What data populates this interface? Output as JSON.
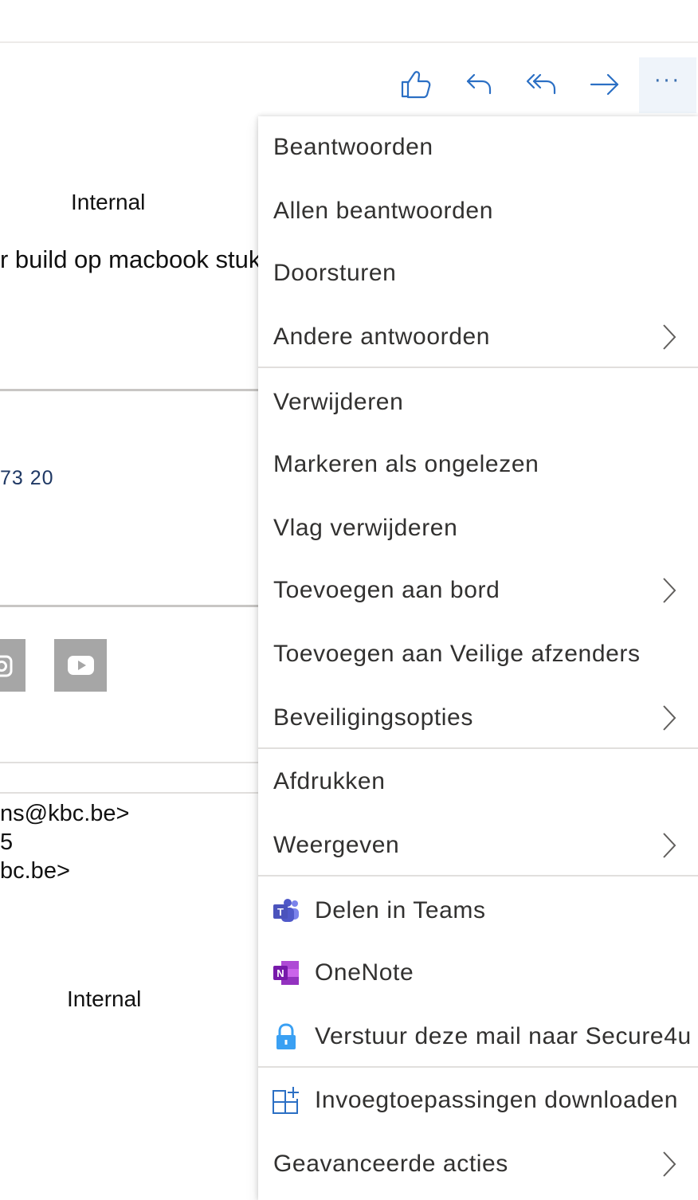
{
  "toolbar": {
    "like_icon": "thumbs-up-icon",
    "reply_icon": "reply-icon",
    "reply_all_icon": "reply-all-icon",
    "forward_icon": "forward-icon",
    "more_label": "···"
  },
  "email_body": {
    "classification_top": "Internal",
    "body_line": "r build op macbook stuk",
    "phone_fragment": "73 20",
    "header_line_1": "ns@kbc.be>",
    "header_line_2": "5",
    "header_line_3": "bc.be>",
    "classification_bottom": "Internal"
  },
  "menu": {
    "items": [
      {
        "label": "Beantwoorden"
      },
      {
        "label": "Allen beantwoorden"
      },
      {
        "label": "Doorsturen"
      },
      {
        "label": "Andere antwoorden",
        "submenu": true
      },
      {
        "label": "Verwijderen"
      },
      {
        "label": "Markeren als ongelezen"
      },
      {
        "label": "Vlag verwijderen"
      },
      {
        "label": "Toevoegen aan bord",
        "submenu": true
      },
      {
        "label": "Toevoegen aan Veilige afzenders"
      },
      {
        "label": "Beveiligingsopties",
        "submenu": true
      },
      {
        "label": "Afdrukken"
      },
      {
        "label": "Weergeven",
        "submenu": true
      },
      {
        "label": "Delen in Teams",
        "icon": "teams-icon"
      },
      {
        "label": "OneNote",
        "icon": "onenote-icon"
      },
      {
        "label": "Verstuur deze mail naar Secure4u",
        "icon": "lock-icon"
      },
      {
        "label": "Invoegtoepassingen downloaden",
        "icon": "add-ins-icon"
      },
      {
        "label": "Geavanceerde acties",
        "submenu": true
      }
    ]
  },
  "colors": {
    "accent": "#2b6fc4",
    "teams": "#5059c9",
    "onenote": "#7719aa",
    "lock": "#3aa0f3"
  }
}
